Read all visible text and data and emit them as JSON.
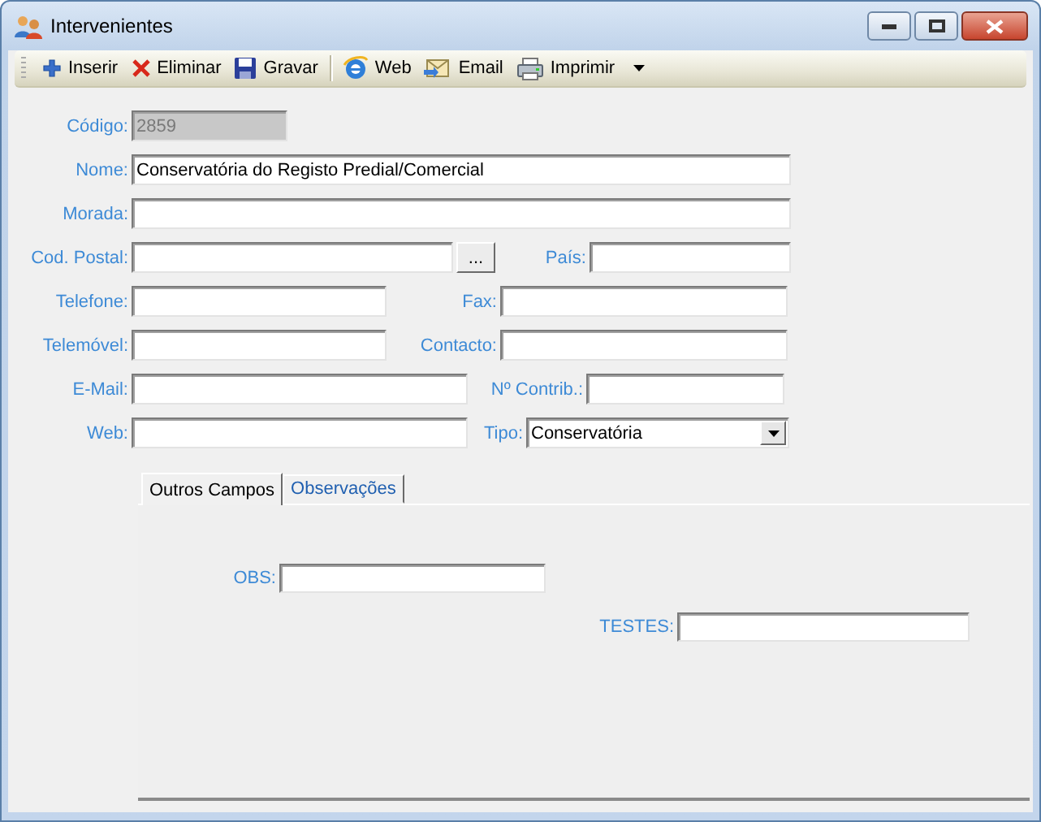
{
  "window": {
    "title": "Intervenientes"
  },
  "toolbar": {
    "groups": [
      [
        {
          "label": "Inserir",
          "kind": "button"
        },
        {
          "label": "Eliminar",
          "kind": "button"
        },
        {
          "label": "Gravar",
          "kind": "button"
        }
      ],
      [
        {
          "label": "Web",
          "kind": "button"
        },
        {
          "label": "Email",
          "kind": "button"
        },
        {
          "label": "Imprimir",
          "kind": "dropdown"
        }
      ]
    ]
  },
  "form": {
    "rows": [
      [
        {
          "label": "Código:",
          "kind": "text",
          "value": "2859",
          "disabled": true
        }
      ],
      [
        {
          "label": "Nome:",
          "kind": "text",
          "value": "Conservatória do Registo Predial/Comercial",
          "disabled": false
        }
      ],
      [
        {
          "label": "Morada:",
          "kind": "text",
          "disabled": false
        }
      ],
      [
        {
          "label": "Cod. Postal:",
          "kind": "lookup",
          "button": "...",
          "disabled": false
        },
        {
          "label": "País:",
          "kind": "text",
          "disabled": false
        }
      ],
      [
        {
          "label": "Telefone:",
          "kind": "text",
          "disabled": false
        },
        {
          "label": "Fax:",
          "kind": "text",
          "disabled": false
        }
      ],
      [
        {
          "label": "Telemóvel:",
          "kind": "text",
          "disabled": false
        },
        {
          "label": "Contacto:",
          "kind": "text",
          "disabled": false
        }
      ],
      [
        {
          "label": "E-Mail:",
          "kind": "text",
          "disabled": false
        },
        {
          "label": "Nº Contrib.:",
          "kind": "text",
          "disabled": false
        }
      ],
      [
        {
          "label": "Web:",
          "kind": "text",
          "disabled": false
        },
        {
          "label": "Tipo:",
          "kind": "select",
          "value": "Conservatória",
          "disabled": false
        }
      ]
    ]
  },
  "tabs": [
    {
      "label": "Outros Campos",
      "selected": true
    },
    {
      "label": "Observações",
      "selected": false
    }
  ],
  "tab_fields": [
    {
      "label": "OBS:"
    },
    {
      "label": "TESTES:"
    }
  ]
}
